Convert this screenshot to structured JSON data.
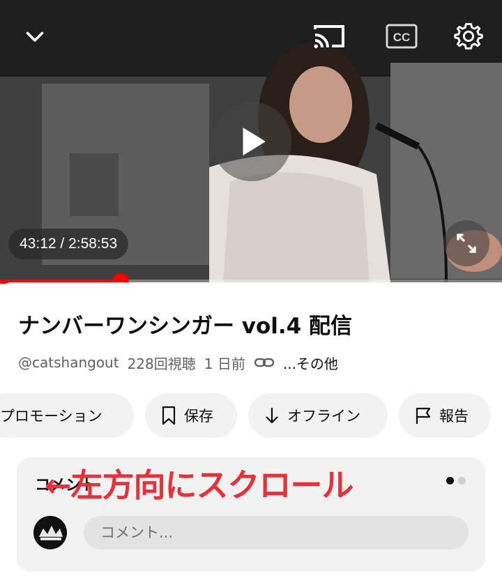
{
  "player": {
    "current_time": "43:12",
    "separator": " / ",
    "duration": "2:58:53",
    "progress_fraction": 0.24,
    "accent_color": "#ff0000",
    "icons": {
      "collapse": "chevron-down-icon",
      "cast": "cast-icon",
      "captions": "closed-captions-icon",
      "settings": "gear-icon",
      "play": "play-icon",
      "fullscreen": "fullscreen-icon"
    }
  },
  "video": {
    "title": "ナンバーワンシンガー vol.4 配信",
    "channel": "@catshangout",
    "views": "228回視聴",
    "age": "1 日前",
    "more": "...その他",
    "link_icon": "link-icon"
  },
  "actions": [
    {
      "label": "プロモーション",
      "icon": ""
    },
    {
      "label": "保存",
      "icon": "bookmark-icon"
    },
    {
      "label": "オフライン",
      "icon": "download-icon"
    },
    {
      "label": "報告",
      "icon": "flag-icon"
    }
  ],
  "comments": {
    "label": "コメント",
    "input_placeholder": "コメント...",
    "page_indicator": {
      "count": 2,
      "active_index": 0,
      "active_color": "#0f0f0f",
      "inactive_color": "#d0d0d0"
    }
  },
  "annotation": {
    "text": "←左方向にスクロール",
    "color": "#e8303a"
  }
}
